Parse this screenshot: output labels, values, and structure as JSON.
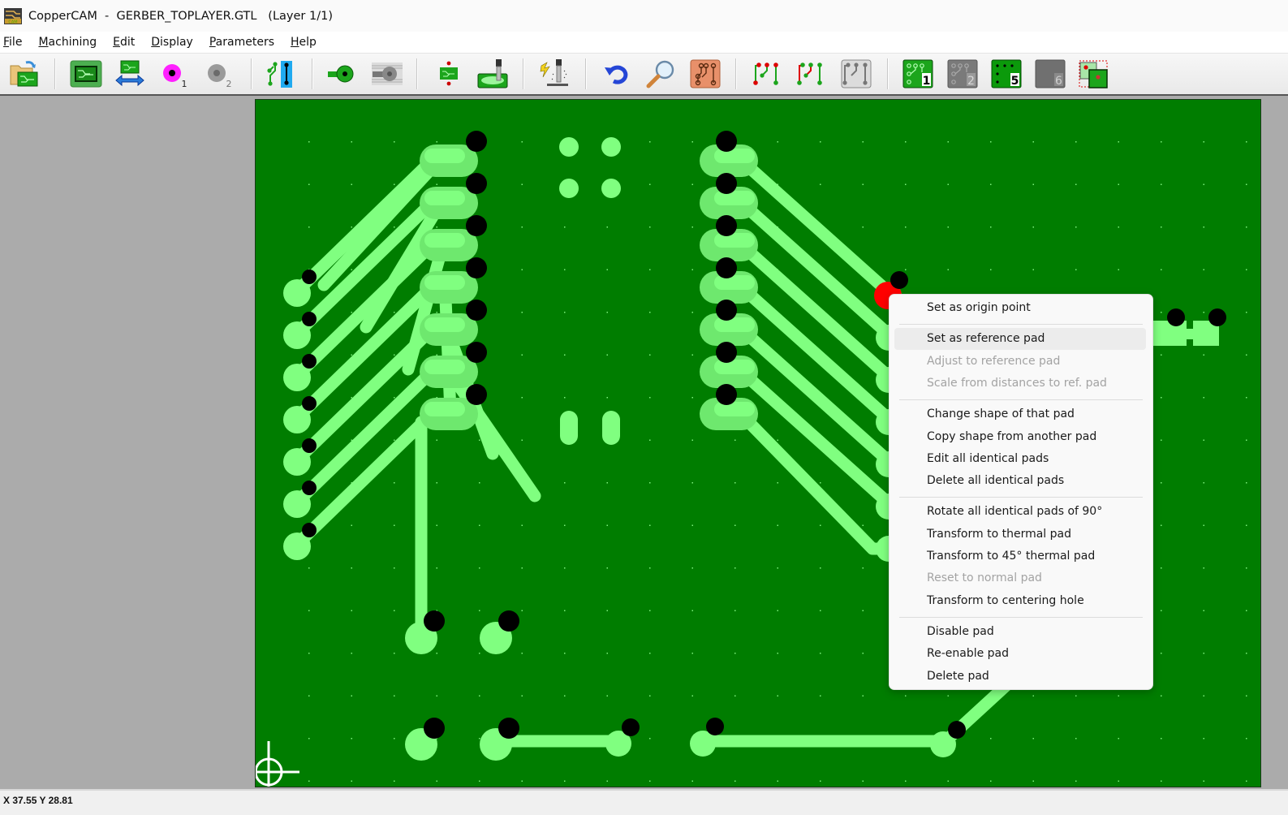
{
  "window": {
    "title": "CopperCAM  -  GERBER_TOPLAYER.GTL   (Layer 1/1)",
    "app_icon": "coppercam-app-icon"
  },
  "menubar": {
    "items": [
      {
        "label": "File",
        "accel": "F"
      },
      {
        "label": "Machining",
        "accel": "M"
      },
      {
        "label": "Edit",
        "accel": "E"
      },
      {
        "label": "Display",
        "accel": "D"
      },
      {
        "label": "Parameters",
        "accel": "P"
      },
      {
        "label": "Help",
        "accel": "H"
      }
    ]
  },
  "toolbar": {
    "buttons": [
      {
        "icon": "open-file-icon"
      },
      {
        "icon": "pcb-layer-icon"
      },
      {
        "icon": "mirror-layer-icon"
      },
      {
        "icon": "reference-pad-1-icon",
        "badge": "1"
      },
      {
        "icon": "reference-pad-2-icon",
        "badge": "2"
      },
      {
        "icon": "tracks-icon"
      },
      {
        "icon": "pad-icon"
      },
      {
        "icon": "pad-contour-icon"
      },
      {
        "icon": "board-dimensions-icon"
      },
      {
        "icon": "milling-cutter-icon"
      },
      {
        "icon": "drill-engrave-icon"
      },
      {
        "icon": "undo-icon"
      },
      {
        "icon": "zoom-icon"
      },
      {
        "icon": "pcb-view-icon"
      },
      {
        "icon": "connect-tracks-red-icon"
      },
      {
        "icon": "connect-tracks-green-icon"
      },
      {
        "icon": "connect-tracks-gray-icon"
      },
      {
        "icon": "engraving-pass-1-icon",
        "badge": "1"
      },
      {
        "icon": "engraving-pass-2-icon",
        "badge": "2"
      },
      {
        "icon": "drilling-pass-5-icon",
        "badge": "5"
      },
      {
        "icon": "cutting-pass-6-icon",
        "badge": "6"
      },
      {
        "icon": "panelize-icon"
      }
    ]
  },
  "context_menu": {
    "groups": [
      [
        {
          "label": "Set as origin point",
          "enabled": true
        }
      ],
      [
        {
          "label": "Set as reference pad",
          "enabled": true,
          "highlighted": true
        },
        {
          "label": "Adjust to reference pad",
          "enabled": false
        },
        {
          "label": "Scale from distances to ref. pad",
          "enabled": false
        }
      ],
      [
        {
          "label": "Change shape of that pad",
          "enabled": true
        },
        {
          "label": "Copy shape from another pad",
          "enabled": true
        },
        {
          "label": "Edit all identical pads",
          "enabled": true
        },
        {
          "label": "Delete all identical pads",
          "enabled": true
        }
      ],
      [
        {
          "label": "Rotate all identical pads of 90°",
          "enabled": true
        },
        {
          "label": "Transform to thermal pad",
          "enabled": true
        },
        {
          "label": "Transform to 45° thermal pad",
          "enabled": true
        },
        {
          "label": "Reset to normal pad",
          "enabled": false
        },
        {
          "label": "Transform to centering hole",
          "enabled": true
        }
      ],
      [
        {
          "label": "Disable pad",
          "enabled": true
        },
        {
          "label": "Re-enable pad",
          "enabled": true
        },
        {
          "label": "Delete pad",
          "enabled": true
        }
      ]
    ]
  },
  "statusbar": {
    "coords": "X 37.55   Y 28.81"
  },
  "colors": {
    "board": "#007d00",
    "copper": "#80ff80",
    "pad_fill": "#6ee86e",
    "hole": "#000000",
    "selected_pad": "#ff0000",
    "workspace": "#ababab"
  }
}
